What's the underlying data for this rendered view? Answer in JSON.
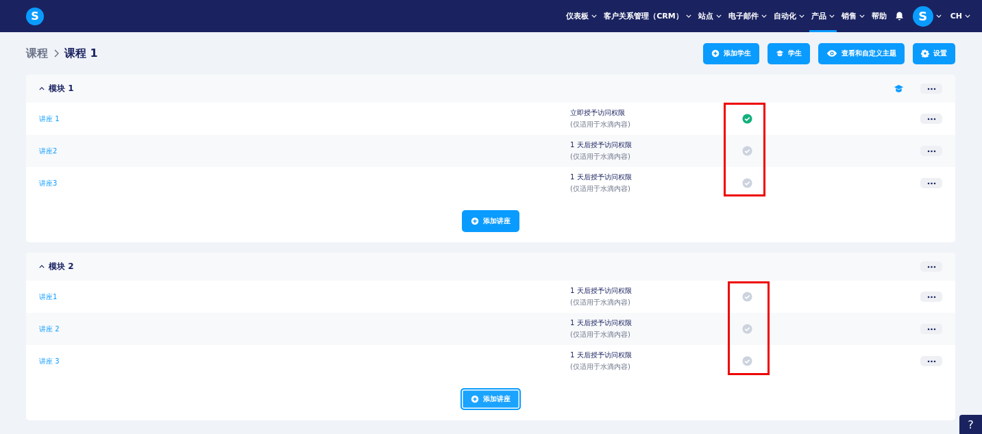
{
  "nav": {
    "logo": "S",
    "items": [
      {
        "label": "仪表板",
        "caret": true,
        "selected": false
      },
      {
        "label": "客户关系管理（CRM）",
        "caret": true,
        "selected": false
      },
      {
        "label": "站点",
        "caret": true,
        "selected": false
      },
      {
        "label": "电子邮件",
        "caret": true,
        "selected": false
      },
      {
        "label": "自动化",
        "caret": true,
        "selected": false
      },
      {
        "label": "产品",
        "caret": true,
        "selected": true
      },
      {
        "label": "销售",
        "caret": true,
        "selected": false
      },
      {
        "label": "帮助",
        "caret": false,
        "selected": false
      }
    ],
    "avatar": "S",
    "language": "CH"
  },
  "breadcrumb": {
    "parent": "课程",
    "current": "课程 1"
  },
  "actions": [
    {
      "kind": "add",
      "label": "添加学生"
    },
    {
      "kind": "students",
      "label": "学生"
    },
    {
      "kind": "view",
      "label": "查看和自定义主题"
    },
    {
      "kind": "settings",
      "label": "设置"
    }
  ],
  "modules": [
    {
      "title": "模块 1",
      "expanded": true,
      "students_icon": true,
      "highlight_frame": true,
      "add_button": {
        "label": "添加讲座",
        "focused": false
      },
      "lectures": [
        {
          "name": "讲座 1",
          "access": "立即授予访问权限",
          "note": "(仅适用于水滴内容)",
          "granted": true
        },
        {
          "name": "讲座2",
          "access": "1 天后授予访问权限",
          "note": "(仅适用于水滴内容)",
          "granted": false
        },
        {
          "name": "讲座3",
          "access": "1 天后授予访问权限",
          "note": "(仅适用于水滴内容)",
          "granted": false
        }
      ]
    },
    {
      "title": "模块 2",
      "expanded": true,
      "students_icon": false,
      "highlight_frame": true,
      "add_button": {
        "label": "添加讲座",
        "focused": true
      },
      "lectures": [
        {
          "name": "讲座1",
          "access": "1 天后授予访问权限",
          "note": "(仅适用于水滴内容)",
          "granted": false
        },
        {
          "name": "讲座 2",
          "access": "1 天后授予访问权限",
          "note": "(仅适用于水滴内容)",
          "granted": false
        },
        {
          "name": "讲座 3",
          "access": "1 天后授予访问权限",
          "note": "(仅适用于水滴内容)",
          "granted": false
        }
      ]
    }
  ],
  "help": "?"
}
